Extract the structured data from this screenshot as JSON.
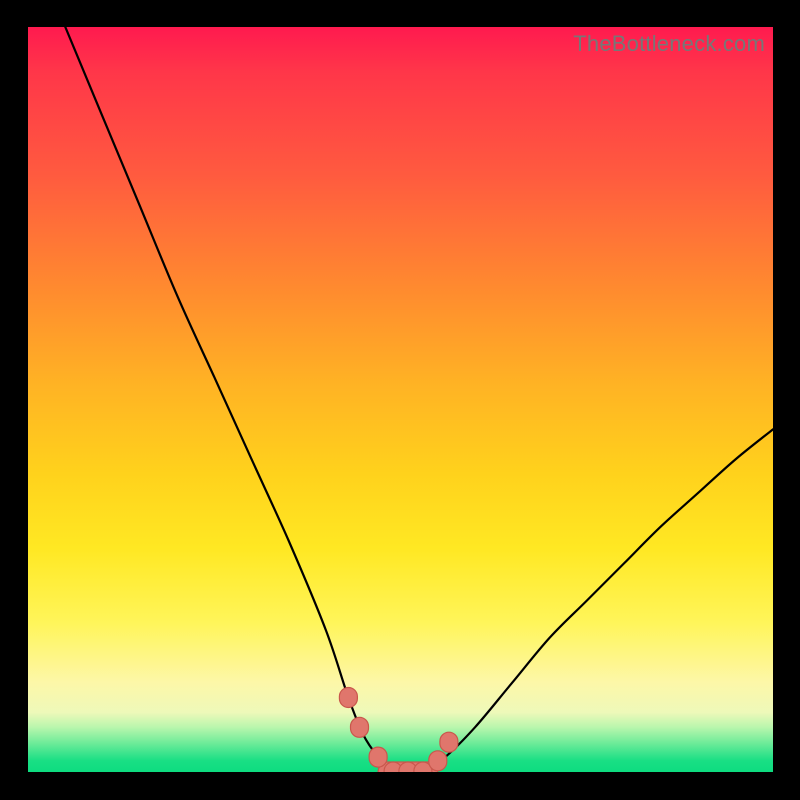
{
  "watermark": "TheBottleneck.com",
  "colors": {
    "top": "#ff1a4f",
    "mid": "#ffe823",
    "bottom": "#0edc80",
    "curve": "#000000",
    "marker_fill": "#e0766c",
    "marker_stroke": "#c9574c",
    "frame": "#000000"
  },
  "chart_data": {
    "type": "line",
    "title": "",
    "xlabel": "",
    "ylabel": "",
    "xlim": [
      0,
      100
    ],
    "ylim": [
      0,
      100
    ],
    "grid": false,
    "legend": false,
    "annotations": [
      "TheBottleneck.com"
    ],
    "series": [
      {
        "name": "bottleneck-curve",
        "x": [
          5,
          10,
          15,
          20,
          25,
          30,
          35,
          40,
          43,
          45,
          47,
          49,
          51,
          53,
          56,
          60,
          65,
          70,
          75,
          80,
          85,
          90,
          95,
          100
        ],
        "y": [
          100,
          88,
          76,
          64,
          53,
          42,
          31,
          19,
          10,
          5,
          2,
          0,
          0,
          0,
          2,
          6,
          12,
          18,
          23,
          28,
          33,
          37.5,
          42,
          46
        ]
      }
    ],
    "markers": {
      "name": "highlighted-points",
      "x": [
        43,
        44.5,
        47,
        49,
        51,
        53,
        55,
        56.5
      ],
      "y": [
        10,
        6,
        2,
        0,
        0,
        0,
        1.5,
        4
      ]
    }
  }
}
